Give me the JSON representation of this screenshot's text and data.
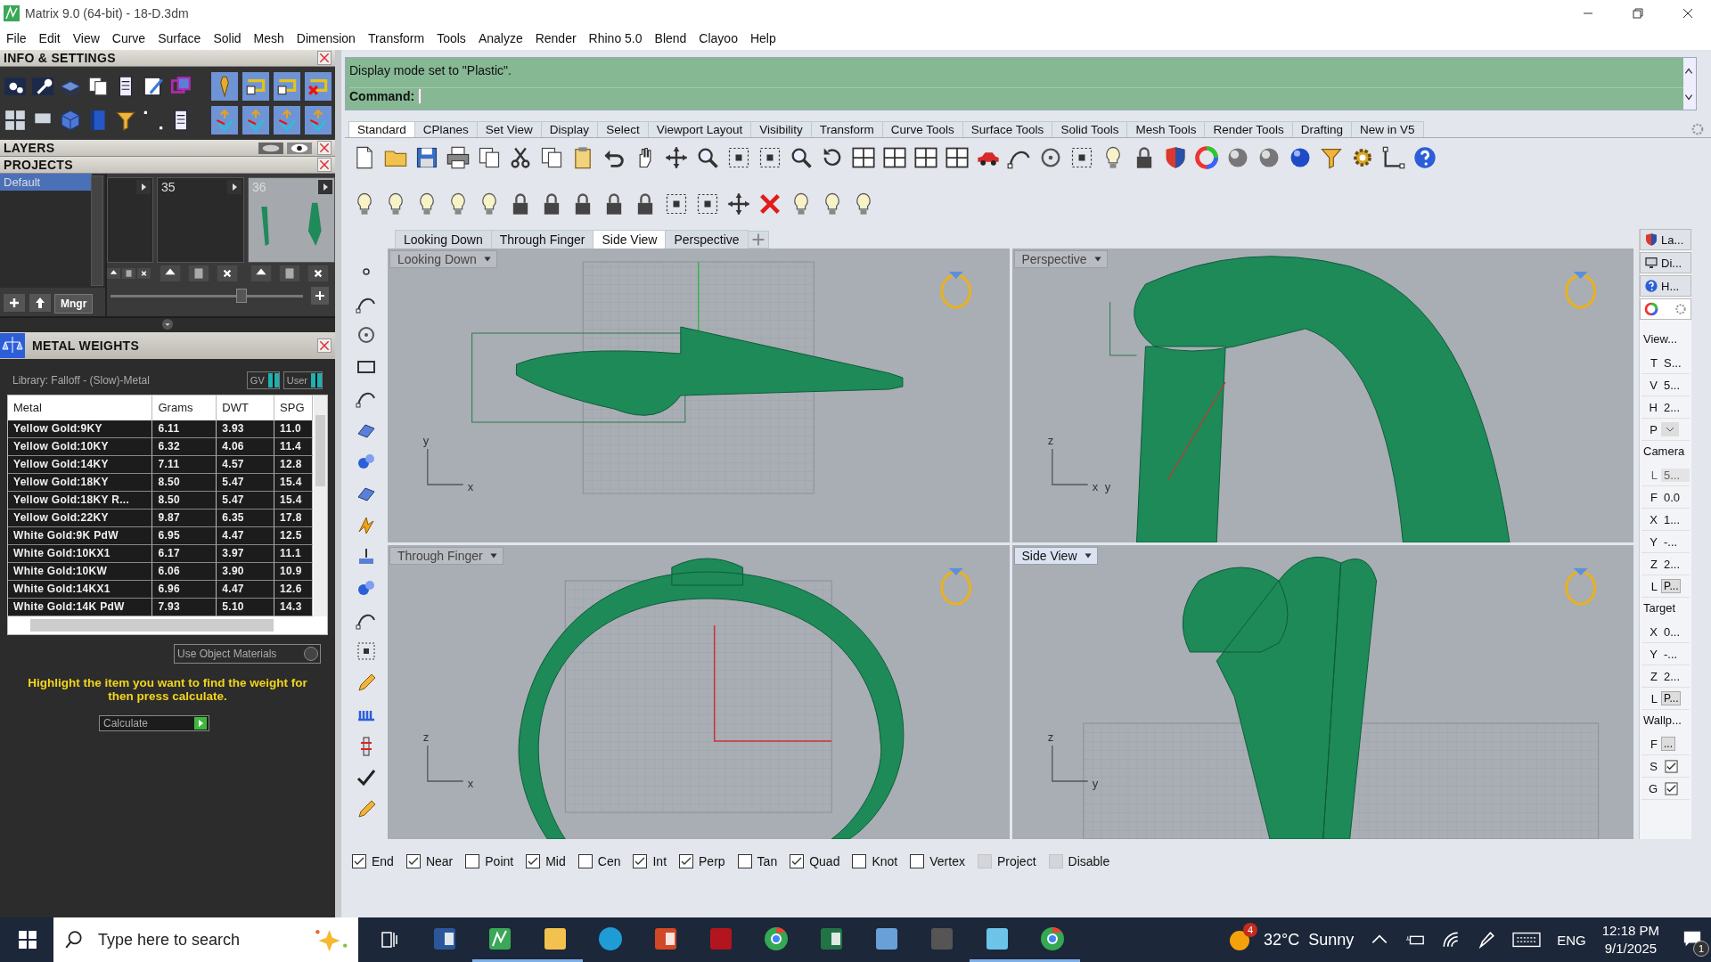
{
  "window": {
    "title": "Matrix 9.0 (64-bit) - 18-D.3dm"
  },
  "menu": [
    "File",
    "Edit",
    "View",
    "Curve",
    "Surface",
    "Solid",
    "Mesh",
    "Dimension",
    "Transform",
    "Tools",
    "Analyze",
    "Render",
    "Rhino 5.0",
    "Blend",
    "Clayoo",
    "Help"
  ],
  "left_panel": {
    "info_settings": {
      "title": "INFO & SETTINGS"
    },
    "layers": {
      "title": "LAYERS"
    },
    "projects": {
      "title": "PROJECTS",
      "list": [
        {
          "label": "Default",
          "selected": true
        }
      ],
      "thumbnails": [
        {
          "kind": "empty",
          "selected": false
        },
        {
          "kind": "empty",
          "number": "35",
          "selected": false
        },
        {
          "kind": "preview",
          "number": "36",
          "selected": true
        }
      ],
      "manager_button": "Mngr",
      "thumbnail_size": {
        "level": 0.68
      }
    },
    "metal_weights": {
      "title": "METAL WEIGHTS",
      "library": "Library: Falloff - (Slow)-Metal",
      "toggles": [
        {
          "label": "GV",
          "on": true
        },
        {
          "label": "User",
          "on": true
        }
      ],
      "columns": [
        "Metal",
        "Grams",
        "DWT",
        "SPG"
      ],
      "rows": [
        [
          "Yellow Gold:9KY",
          "6.11",
          "3.93",
          "11.0"
        ],
        [
          "Yellow Gold:10KY",
          "6.32",
          "4.06",
          "11.4"
        ],
        [
          "Yellow Gold:14KY",
          "7.11",
          "4.57",
          "12.8"
        ],
        [
          "Yellow Gold:18KY",
          "8.50",
          "5.47",
          "15.4"
        ],
        [
          "Yellow Gold:18KY R...",
          "8.50",
          "5.47",
          "15.4"
        ],
        [
          "Yellow Gold:22KY",
          "9.87",
          "6.35",
          "17.8"
        ],
        [
          "White Gold:9K PdW",
          "6.95",
          "4.47",
          "12.5"
        ],
        [
          "White Gold:10KX1",
          "6.17",
          "3.97",
          "11.1"
        ],
        [
          "White Gold:10KW",
          "6.06",
          "3.90",
          "10.9"
        ],
        [
          "White Gold:14KX1",
          "6.96",
          "4.47",
          "12.6"
        ],
        [
          "White Gold:14K PdW",
          "7.93",
          "5.10",
          "14.3"
        ]
      ],
      "use_object_materials": {
        "label": "Use Object Materials",
        "checked": false
      },
      "hint": "Highlight the item you want to find the weight for then press calculate.",
      "calculate": "Calculate"
    }
  },
  "command": {
    "history": "Display mode set to \"Plastic\".",
    "prompt": "Command:"
  },
  "toolbar_tabs": [
    {
      "label": "Standard",
      "selected": true
    },
    {
      "label": "CPlanes",
      "selected": false
    },
    {
      "label": "Set View",
      "selected": false
    },
    {
      "label": "Display",
      "selected": false
    },
    {
      "label": "Select",
      "selected": false
    },
    {
      "label": "Viewport Layout",
      "selected": false
    },
    {
      "label": "Visibility",
      "selected": false
    },
    {
      "label": "Transform",
      "selected": false
    },
    {
      "label": "Curve Tools",
      "selected": false
    },
    {
      "label": "Surface Tools",
      "selected": false
    },
    {
      "label": "Solid Tools",
      "selected": false
    },
    {
      "label": "Mesh Tools",
      "selected": false
    },
    {
      "label": "Render Tools",
      "selected": false
    },
    {
      "label": "Drafting",
      "selected": false
    },
    {
      "label": "New in V5",
      "selected": false
    }
  ],
  "viewport_tabs": [
    {
      "label": "Looking Down",
      "selected": false
    },
    {
      "label": "Through Finger",
      "selected": false
    },
    {
      "label": "Side View",
      "selected": true
    },
    {
      "label": "Perspective",
      "selected": false
    }
  ],
  "viewports": [
    {
      "title": "Looking Down",
      "kind": "top",
      "active": false,
      "axes": [
        "y",
        "x"
      ]
    },
    {
      "title": "Perspective",
      "kind": "perspective",
      "active": false,
      "axes": [
        "z",
        "x",
        "y"
      ]
    },
    {
      "title": "Through Finger",
      "kind": "front",
      "active": false,
      "axes": [
        "z",
        "x"
      ]
    },
    {
      "title": "Side View",
      "kind": "side",
      "active": true,
      "axes": [
        "z",
        "y"
      ]
    }
  ],
  "properties_panel": {
    "tabs": [
      {
        "label": "La...",
        "kind": "layers",
        "selected": false
      },
      {
        "label": "Di...",
        "kind": "display",
        "selected": false
      },
      {
        "label": "H...",
        "kind": "help",
        "selected": false
      },
      {
        "kind": "color",
        "selected": true
      }
    ],
    "sections": [
      {
        "title": "View...",
        "rows": [
          {
            "label": "T",
            "kind": "text",
            "value": "S..."
          },
          {
            "label": "V",
            "kind": "text",
            "value": "5..."
          },
          {
            "label": "H",
            "kind": "text",
            "value": "2..."
          },
          {
            "label": "P",
            "kind": "dropdown"
          }
        ]
      },
      {
        "title": "Camera",
        "rows": [
          {
            "label": "L",
            "kind": "text",
            "value": "5...",
            "disabled": true
          },
          {
            "label": "F",
            "kind": "text",
            "value": "0.0"
          },
          {
            "label": "X",
            "kind": "text",
            "value": "1..."
          },
          {
            "label": "Y",
            "kind": "text",
            "value": "-..."
          },
          {
            "label": "Z",
            "kind": "text",
            "value": "2..."
          },
          {
            "label": "L",
            "kind": "button",
            "value": "P..."
          }
        ]
      },
      {
        "title": "Target",
        "rows": [
          {
            "label": "X",
            "kind": "text",
            "value": "0..."
          },
          {
            "label": "Y",
            "kind": "text",
            "value": "-..."
          },
          {
            "label": "Z",
            "kind": "text",
            "value": "2..."
          },
          {
            "label": "L",
            "kind": "button",
            "value": "P..."
          }
        ]
      },
      {
        "title": "Wallp...",
        "rows": [
          {
            "label": "F",
            "kind": "button",
            "value": "..."
          },
          {
            "label": "S",
            "kind": "checkbox",
            "checked": true
          },
          {
            "label": "G",
            "kind": "checkbox",
            "checked": true
          }
        ]
      }
    ]
  },
  "snaps": [
    {
      "label": "End",
      "checked": true,
      "disabled": false
    },
    {
      "label": "Near",
      "checked": true,
      "disabled": false
    },
    {
      "label": "Point",
      "checked": false,
      "disabled": false
    },
    {
      "label": "Mid",
      "checked": true,
      "disabled": false
    },
    {
      "label": "Cen",
      "checked": false,
      "disabled": false
    },
    {
      "label": "Int",
      "checked": true,
      "disabled": false
    },
    {
      "label": "Perp",
      "checked": true,
      "disabled": false
    },
    {
      "label": "Tan",
      "checked": false,
      "disabled": false
    },
    {
      "label": "Quad",
      "checked": true,
      "disabled": false
    },
    {
      "label": "Knot",
      "checked": false,
      "disabled": false
    },
    {
      "label": "Vertex",
      "checked": false,
      "disabled": false
    },
    {
      "label": "Project",
      "checked": false,
      "disabled": true
    },
    {
      "label": "Disable",
      "checked": false,
      "disabled": true
    }
  ],
  "taskbar": {
    "search_placeholder": "Type here to search",
    "apps": [
      {
        "kind": "word",
        "running": false
      },
      {
        "kind": "matrix",
        "running": true
      },
      {
        "kind": "folder",
        "running": true
      },
      {
        "kind": "edge",
        "running": false
      },
      {
        "kind": "powerpoint",
        "running": false
      },
      {
        "kind": "solidworks",
        "running": false
      },
      {
        "kind": "chrome",
        "running": false
      },
      {
        "kind": "excel",
        "running": false
      },
      {
        "kind": "remote",
        "running": false
      },
      {
        "kind": "rhino",
        "running": false
      },
      {
        "kind": "notepad",
        "running": true
      },
      {
        "kind": "chrome",
        "running": true
      }
    ],
    "weather": {
      "badge": "4",
      "temperature": "32°C",
      "condition": "Sunny"
    },
    "language": "ENG",
    "time": "12:18 PM",
    "date": "9/1/2025",
    "notifications": "1"
  }
}
